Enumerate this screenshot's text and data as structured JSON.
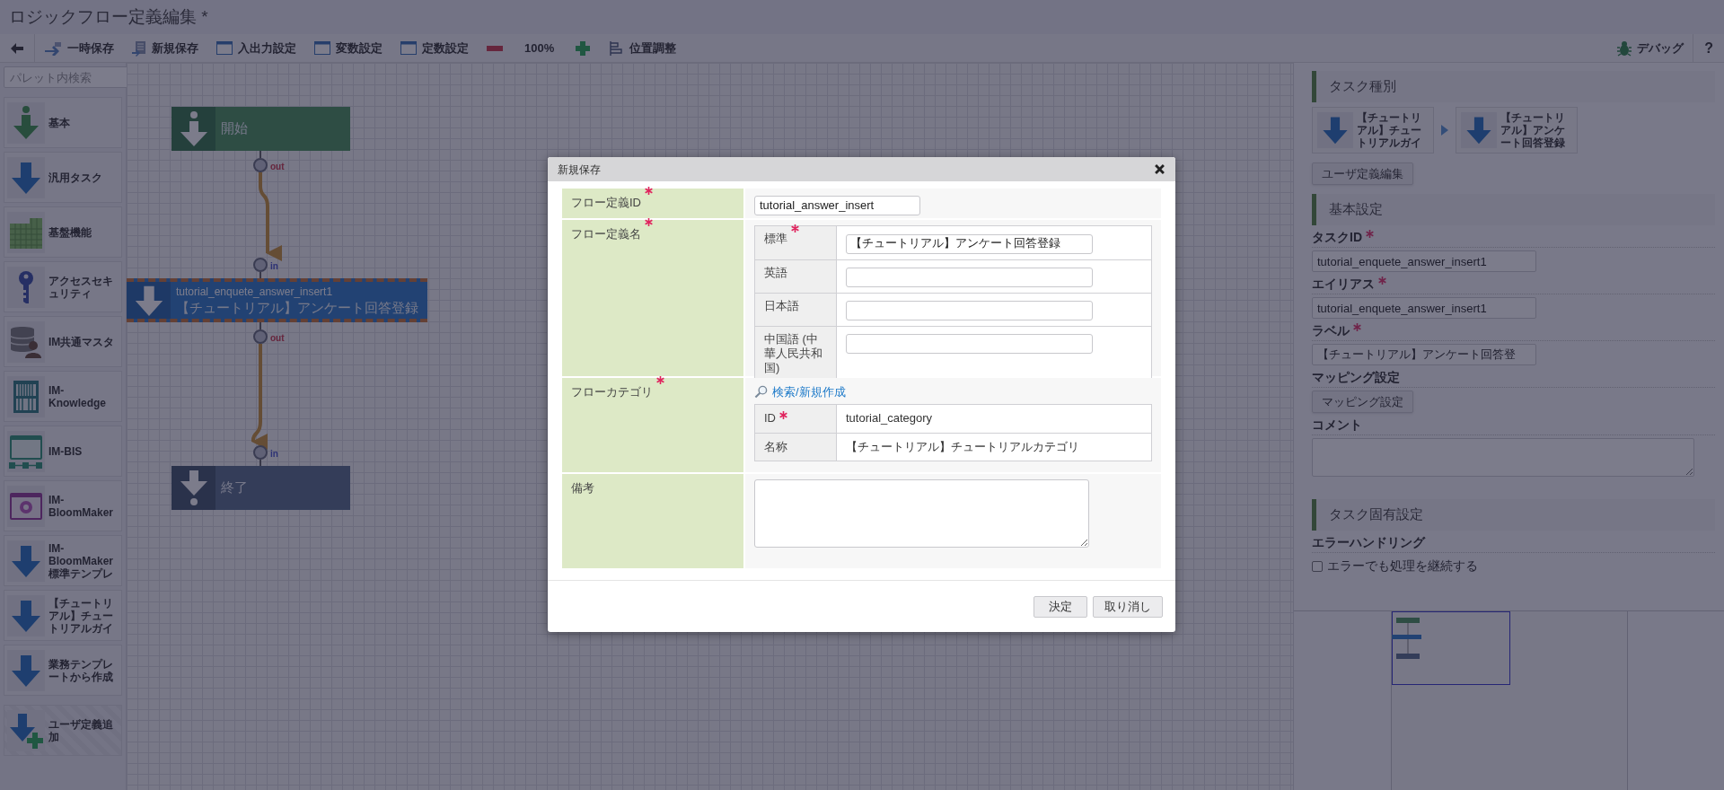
{
  "window": {
    "title": "ロジックフロー定義編集 *"
  },
  "toolbar": {
    "items": [
      {
        "kind": "save-temp",
        "label": "一時保存"
      },
      {
        "kind": "save-new",
        "label": "新規保存"
      },
      {
        "kind": "window",
        "label": "入出力設定"
      },
      {
        "kind": "window",
        "label": "変数設定"
      },
      {
        "kind": "window",
        "label": "定数設定"
      },
      {
        "kind": "zoom-out"
      },
      {
        "kind": "zoom-level",
        "label": "100%"
      },
      {
        "kind": "zoom-in"
      },
      {
        "kind": "align",
        "label": "位置調整"
      }
    ],
    "right": [
      {
        "kind": "debug",
        "label": "デバッグ"
      },
      {
        "kind": "help",
        "label": "?"
      }
    ]
  },
  "palette": {
    "search_placeholder": "パレット内検索",
    "items": [
      {
        "kind": "basic",
        "label": "基本"
      },
      {
        "kind": "task",
        "label": "汎用タスク"
      },
      {
        "kind": "grid",
        "label": "基盤機能"
      },
      {
        "kind": "key",
        "label": "アクセスセキュリティ"
      },
      {
        "kind": "db",
        "label": "IM共通マスタ"
      },
      {
        "kind": "knowledge",
        "label": "IM-Knowledge"
      },
      {
        "kind": "bis",
        "label": "IM-BIS"
      },
      {
        "kind": "bloom",
        "label": "IM-BloomMaker"
      },
      {
        "kind": "task",
        "label": "IM-BloomMaker標準テンプレ"
      },
      {
        "kind": "task",
        "label": "【チュートリアル】チュートリアルガイ"
      },
      {
        "kind": "task",
        "label": "業務テンプレートから作成"
      },
      {
        "kind": "add",
        "label": "ユーザ定義追加"
      }
    ]
  },
  "canvas": {
    "nodes": [
      {
        "kind": "start",
        "label": "開始",
        "out": "out",
        "selected": false
      },
      {
        "kind": "task",
        "id": "tutorial_enquete_answer_insert1",
        "label": "【チュートリアル】アンケート回答登録",
        "in": "in",
        "out": "out",
        "selected": true
      },
      {
        "kind": "end",
        "label": "終了",
        "in": "in",
        "selected": false
      }
    ]
  },
  "properties": {
    "task_type": {
      "title": "タスク種別",
      "path": [
        {
          "label": "【チュートリアル】チュートリアルガイ"
        },
        {
          "label": "【チュートリアル】アンケート回答登録"
        }
      ],
      "button": "ユーザ定義編集"
    },
    "basic": {
      "title": "基本設定",
      "fields": [
        {
          "label": "タスクID",
          "required": true,
          "value": "tutorial_enquete_answer_insert1"
        },
        {
          "label": "エイリアス",
          "required": true,
          "value": "tutorial_enquete_answer_insert1"
        },
        {
          "label": "ラベル",
          "required": true,
          "value": "【チュートリアル】アンケート回答登"
        }
      ],
      "mapping": {
        "label": "マッピング設定",
        "button": "マッピング設定"
      },
      "comment": {
        "label": "コメント"
      }
    },
    "specific": {
      "title": "タスク固有設定",
      "error_handling": {
        "label": "エラーハンドリング",
        "checkbox": {
          "label": "エラーでも処理を継続する",
          "checked": false
        }
      }
    }
  },
  "dialog": {
    "title": "新規保存",
    "rows": [
      {
        "kind": "input",
        "label": "フロー定義ID",
        "required": true,
        "value": "tutorial_answer_insert"
      },
      {
        "kind": "localized",
        "label": "フロー定義名",
        "required": true,
        "languages": [
          {
            "label": "標準",
            "required": true,
            "value": "【チュートリアル】アンケート回答登録"
          },
          {
            "label": "英語",
            "required": false
          },
          {
            "label": "日本語",
            "required": false
          },
          {
            "label": "中国語 (中華人民共和国)",
            "required": false
          }
        ]
      },
      {
        "kind": "category",
        "label": "フローカテゴリ",
        "required": true,
        "link": "検索/新規作成",
        "fields": [
          {
            "label": "ID",
            "required": true,
            "value": "tutorial_category"
          },
          {
            "label": "名称",
            "required": false,
            "value": "【チュートリアル】チュートリアルカテゴリ"
          }
        ]
      },
      {
        "kind": "textarea",
        "label": "備考",
        "required": false
      }
    ],
    "buttons": [
      "決定",
      "取り消し"
    ]
  }
}
